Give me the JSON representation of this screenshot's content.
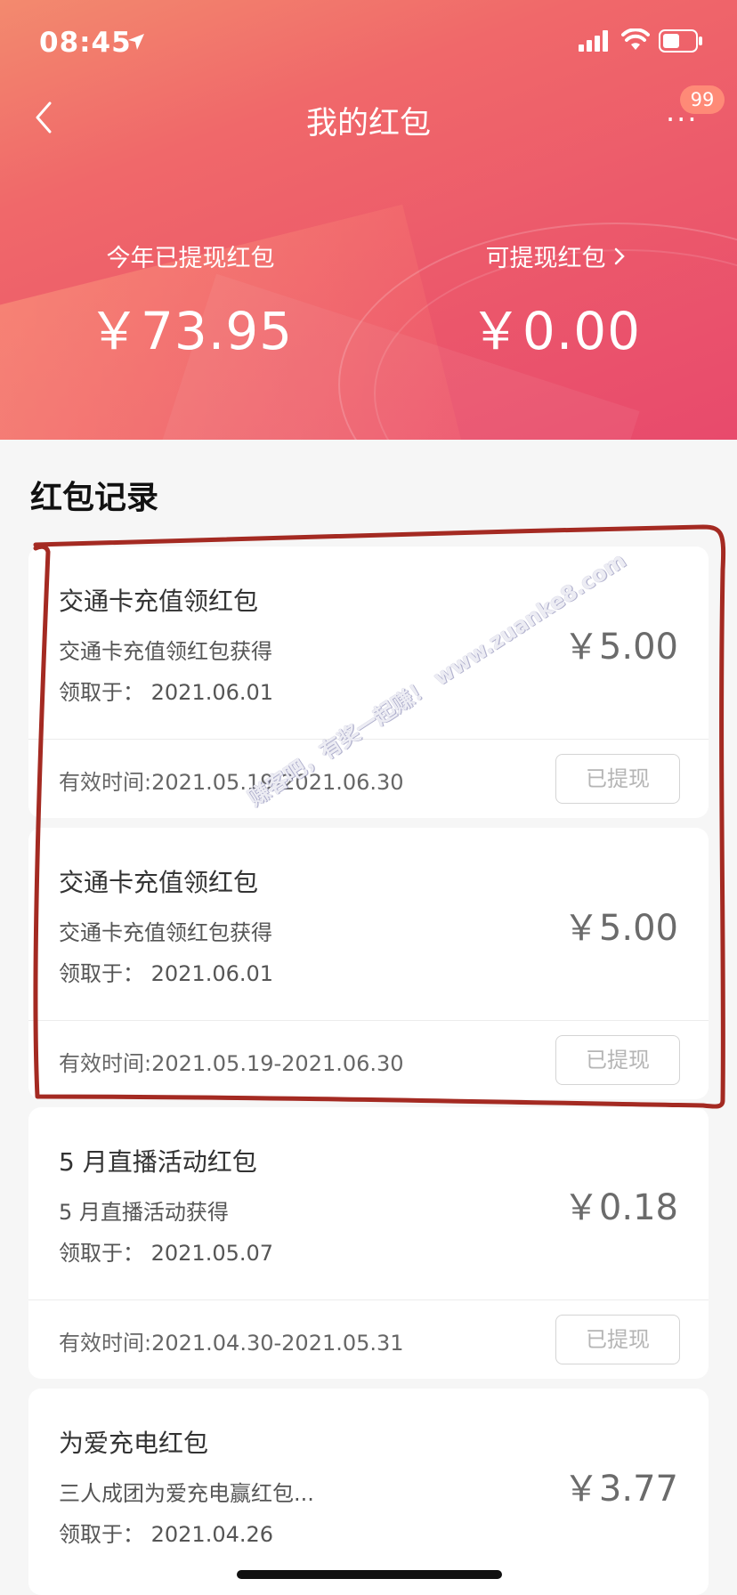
{
  "status_bar": {
    "time": "08:45"
  },
  "nav": {
    "title": "我的红包",
    "badge": "99",
    "more": "···"
  },
  "summary": {
    "withdrawn_label": "今年已提现红包",
    "withdrawn_value": "￥73.95",
    "available_label": "可提现红包",
    "available_value": "￥0.00"
  },
  "section": {
    "title": "红包记录"
  },
  "records": [
    {
      "name": "交通卡充值领红包",
      "desc": "交通卡充值领红包获得",
      "date": "领取于：  2021.06.01",
      "amount": "￥5.00",
      "valid": "有效时间:2021.05.19-2021.06.30",
      "button": "已提现"
    },
    {
      "name": "交通卡充值领红包",
      "desc": "交通卡充值领红包获得",
      "date": "领取于：  2021.06.01",
      "amount": "￥5.00",
      "valid": "有效时间:2021.05.19-2021.06.30",
      "button": "已提现"
    },
    {
      "name": "5 月直播活动红包",
      "desc": "5 月直播活动获得",
      "date": "领取于：  2021.05.07",
      "amount": "￥0.18",
      "valid": "有效时间:2021.04.30-2021.05.31",
      "button": "已提现"
    },
    {
      "name": "为爱充电红包",
      "desc": "三人成团为爱充电赢红包...",
      "date": "领取于：  2021.04.26",
      "amount": "￥3.77"
    }
  ],
  "watermark": "赚客吧，有奖一起赚！ www.zuanke8.com",
  "colors": {
    "header_start": "#f38a6e",
    "header_end": "#e84a6c",
    "annotation": "#a42a22"
  }
}
